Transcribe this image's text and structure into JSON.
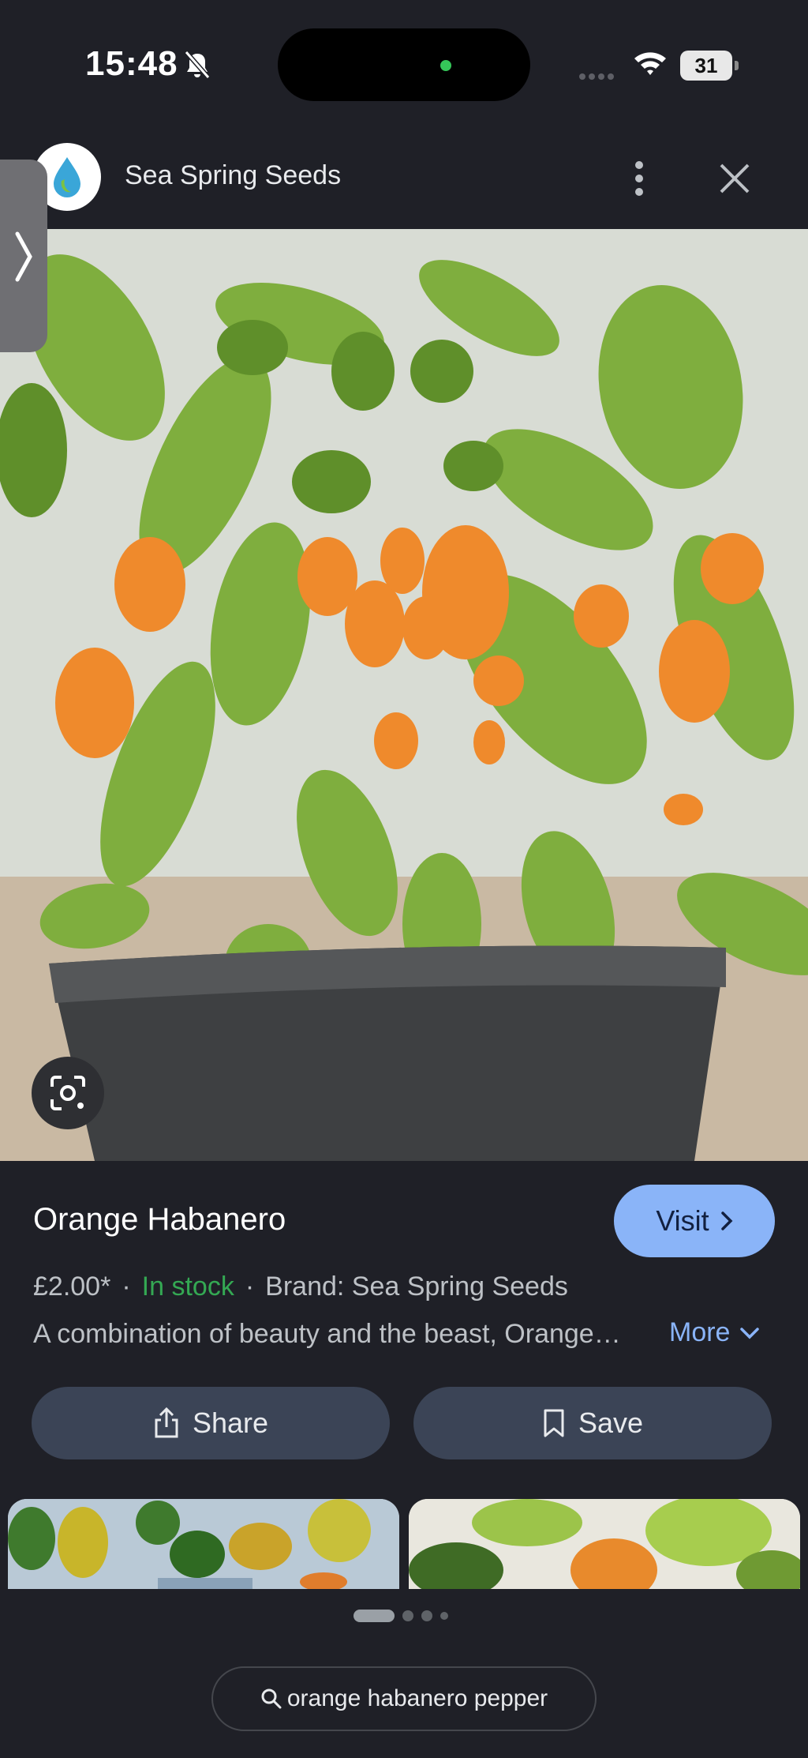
{
  "status_bar": {
    "time": "15:48",
    "battery": "31"
  },
  "header": {
    "site_name": "Sea Spring Seeds"
  },
  "product": {
    "title": "Orange Habanero",
    "visit_label": "Visit",
    "price": "£2.00*",
    "stock": "In stock",
    "brand": "Brand: Sea Spring Seeds",
    "description": "A combination of beauty and the beast, Orange…",
    "more_label": "More"
  },
  "actions": {
    "share_label": "Share",
    "save_label": "Save"
  },
  "search_chip": {
    "query": "orange habanero pepper"
  },
  "colors": {
    "background": "#1f2027",
    "accent": "#8ab4f8",
    "in_stock": "#34a853",
    "button_bg": "#3b4456"
  },
  "icons": [
    "bell-slash-icon",
    "wifi-icon",
    "battery-icon",
    "more-vert-icon",
    "close-icon",
    "chevron-right-icon",
    "lens-icon",
    "share-icon",
    "bookmark-icon",
    "chevron-down-icon",
    "search-icon"
  ]
}
